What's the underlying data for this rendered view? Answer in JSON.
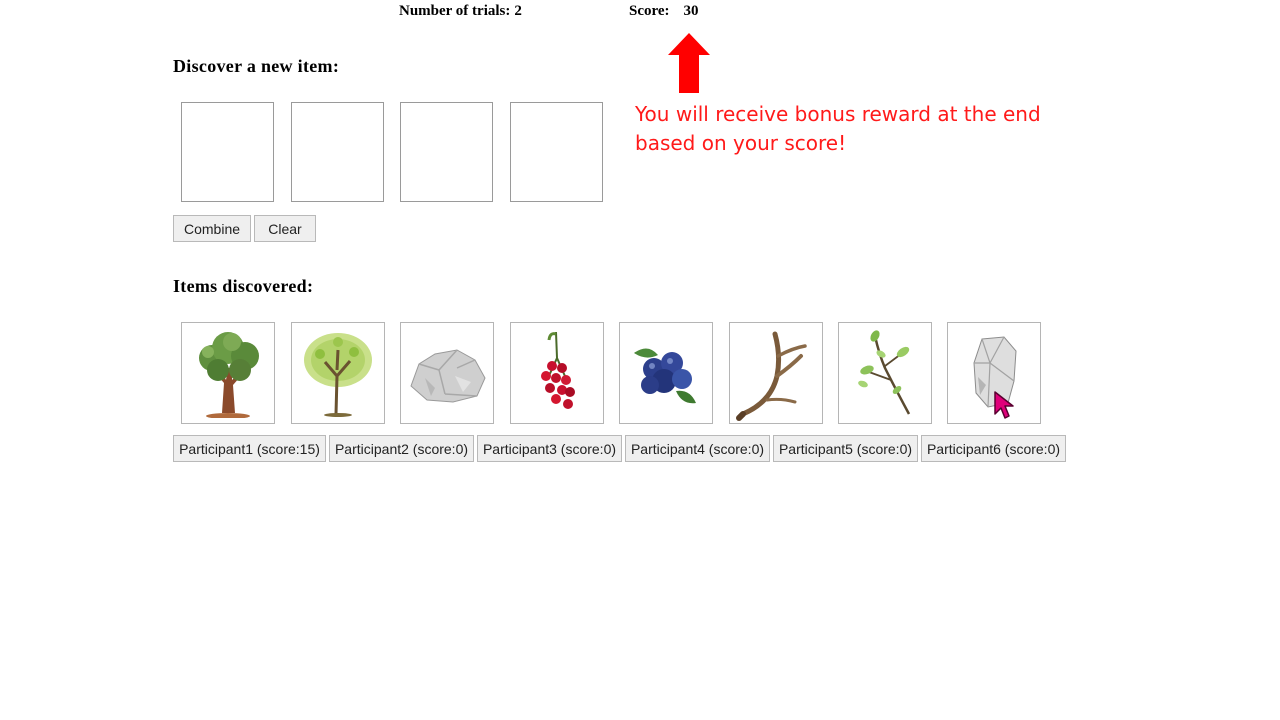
{
  "header": {
    "trials_label": "Number of trials:",
    "trials_value": "2",
    "score_label": "Score:",
    "score_value": "30"
  },
  "discover": {
    "title": "Discover a new item:",
    "combine_label": "Combine",
    "clear_label": "Clear"
  },
  "bonus_note": "You will receive bonus reward at the end based on your score!",
  "items_section": {
    "title": "Items discovered:",
    "items": [
      {
        "icon": "oak-tree-icon"
      },
      {
        "icon": "young-tree-icon"
      },
      {
        "icon": "rock-icon"
      },
      {
        "icon": "red-berries-icon"
      },
      {
        "icon": "blueberries-icon"
      },
      {
        "icon": "antler-icon"
      },
      {
        "icon": "twig-icon"
      },
      {
        "icon": "stone-flake-icon"
      }
    ]
  },
  "participants": [
    {
      "label": "Participant1 (score:15)"
    },
    {
      "label": "Participant2 (score:0)"
    },
    {
      "label": "Participant3 (score:0)"
    },
    {
      "label": "Participant4 (score:0)"
    },
    {
      "label": "Participant5 (score:0)"
    },
    {
      "label": "Participant6 (score:0)"
    }
  ],
  "colors": {
    "accent": "#ff0000",
    "cursor": "#e0007a"
  }
}
